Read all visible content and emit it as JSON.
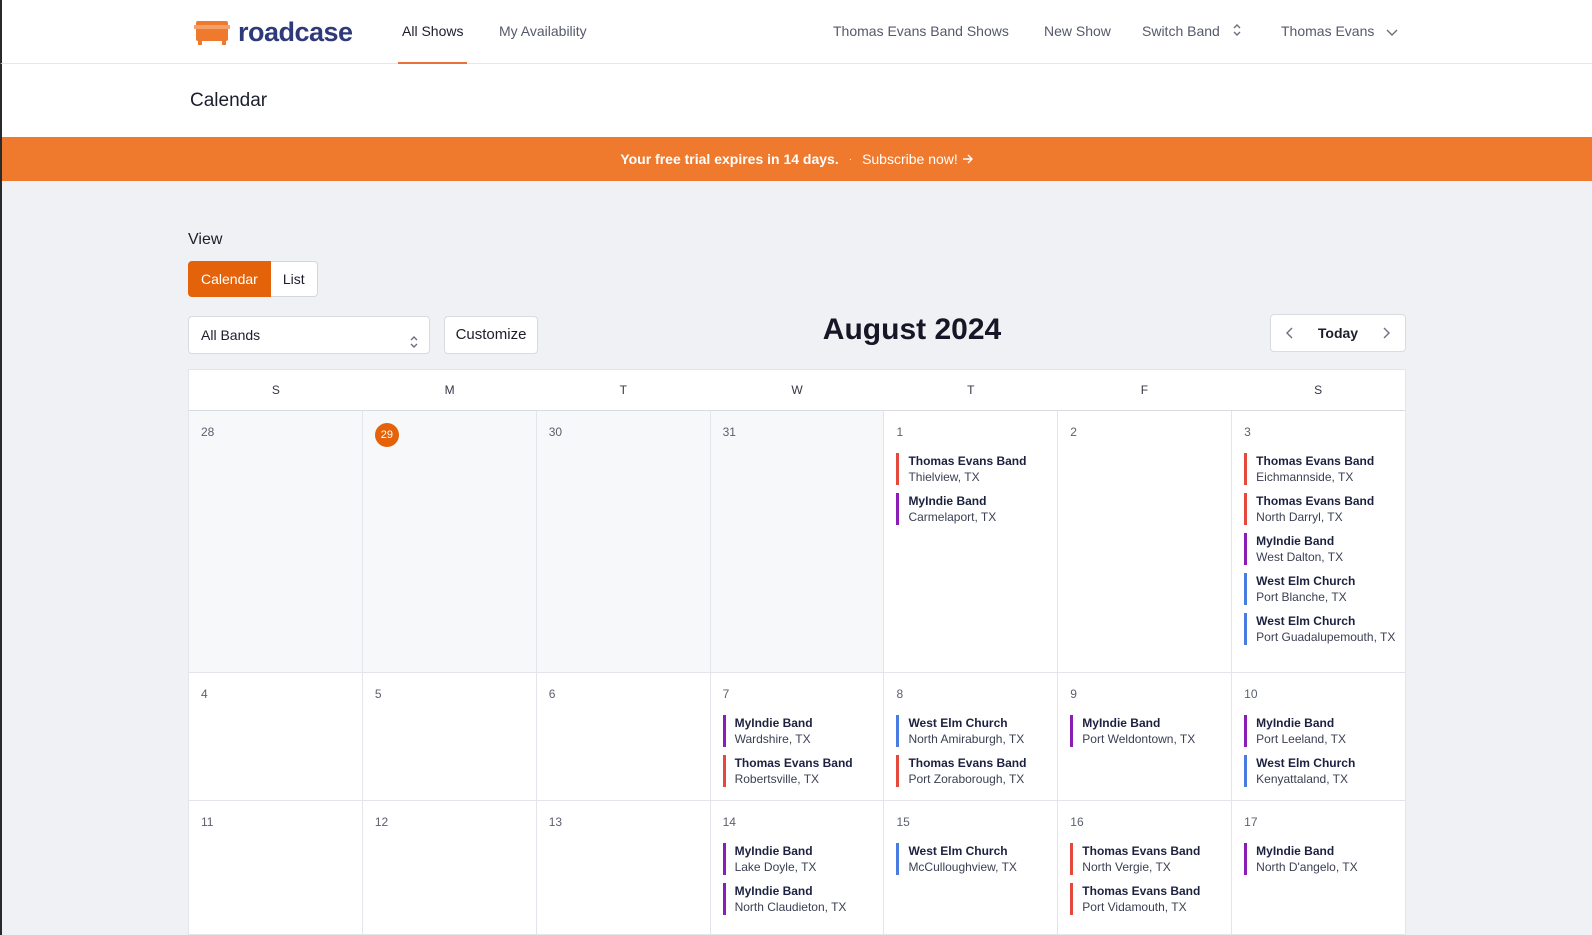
{
  "app": {
    "logo_text": "roadcase"
  },
  "nav": {
    "all_shows": "All Shows",
    "my_availability": "My Availability",
    "band_shows": "Thomas Evans Band Shows",
    "new_show": "New Show",
    "switch_band": "Switch Band",
    "user": "Thomas Evans"
  },
  "page": {
    "title": "Calendar"
  },
  "banner": {
    "message": "Your free trial expires in 14 days.",
    "separator": "·",
    "link": "Subscribe now!"
  },
  "view": {
    "label": "View",
    "calendar_btn": "Calendar",
    "list_btn": "List"
  },
  "filters": {
    "band_select": "All Bands",
    "customize": "Customize"
  },
  "month": {
    "title": "August 2024",
    "today_btn": "Today"
  },
  "colors": {
    "accent": "#e4620a",
    "banner": "#ef7a2e",
    "thomas_evans_band": "#e5483c",
    "myindie_band": "#8a1db5",
    "west_elm_church": "#4a7be0"
  },
  "weekdays": [
    "S",
    "M",
    "T",
    "W",
    "T",
    "F",
    "S"
  ],
  "weeks": [
    [
      {
        "num": "28",
        "past": true,
        "events": []
      },
      {
        "num": "29",
        "past": true,
        "today": true,
        "events": []
      },
      {
        "num": "30",
        "past": true,
        "events": []
      },
      {
        "num": "31",
        "past": true,
        "events": []
      },
      {
        "num": "1",
        "events": [
          {
            "band": "Thomas Evans Band",
            "place": "Thielview, TX",
            "color": "#e5483c"
          },
          {
            "band": "MyIndie Band",
            "place": "Carmelaport, TX",
            "color": "#8a1db5"
          }
        ]
      },
      {
        "num": "2",
        "events": []
      },
      {
        "num": "3",
        "events": [
          {
            "band": "Thomas Evans Band",
            "place": "Eichmannside, TX",
            "color": "#e5483c"
          },
          {
            "band": "Thomas Evans Band",
            "place": "North Darryl, TX",
            "color": "#e5483c"
          },
          {
            "band": "MyIndie Band",
            "place": "West Dalton, TX",
            "color": "#8a1db5"
          },
          {
            "band": "West Elm Church",
            "place": "Port Blanche, TX",
            "color": "#4a7be0"
          },
          {
            "band": "West Elm Church",
            "place": "Port Guadalupemouth, TX",
            "color": "#4a7be0"
          }
        ]
      }
    ],
    [
      {
        "num": "4",
        "events": []
      },
      {
        "num": "5",
        "events": []
      },
      {
        "num": "6",
        "events": []
      },
      {
        "num": "7",
        "events": [
          {
            "band": "MyIndie Band",
            "place": "Wardshire, TX",
            "color": "#8a1db5"
          },
          {
            "band": "Thomas Evans Band",
            "place": "Robertsville, TX",
            "color": "#e5483c"
          }
        ]
      },
      {
        "num": "8",
        "events": [
          {
            "band": "West Elm Church",
            "place": "North Amiraburgh, TX",
            "color": "#4a7be0"
          },
          {
            "band": "Thomas Evans Band",
            "place": "Port Zoraborough, TX",
            "color": "#e5483c"
          }
        ]
      },
      {
        "num": "9",
        "events": [
          {
            "band": "MyIndie Band",
            "place": "Port Weldontown, TX",
            "color": "#8a1db5"
          }
        ]
      },
      {
        "num": "10",
        "events": [
          {
            "band": "MyIndie Band",
            "place": "Port Leeland, TX",
            "color": "#8a1db5"
          },
          {
            "band": "West Elm Church",
            "place": "Kenyattaland, TX",
            "color": "#4a7be0"
          }
        ]
      }
    ],
    [
      {
        "num": "11",
        "events": []
      },
      {
        "num": "12",
        "events": []
      },
      {
        "num": "13",
        "events": []
      },
      {
        "num": "14",
        "events": [
          {
            "band": "MyIndie Band",
            "place": "Lake Doyle, TX",
            "color": "#8a1db5"
          },
          {
            "band": "MyIndie Band",
            "place": "North Claudieton, TX",
            "color": "#8a1db5"
          }
        ]
      },
      {
        "num": "15",
        "events": [
          {
            "band": "West Elm Church",
            "place": "McCulloughview, TX",
            "color": "#4a7be0"
          }
        ]
      },
      {
        "num": "16",
        "events": [
          {
            "band": "Thomas Evans Band",
            "place": "North Vergie, TX",
            "color": "#e5483c"
          },
          {
            "band": "Thomas Evans Band",
            "place": "Port Vidamouth, TX",
            "color": "#e5483c"
          }
        ]
      },
      {
        "num": "17",
        "events": [
          {
            "band": "MyIndie Band",
            "place": "North D'angelo, TX",
            "color": "#8a1db5"
          }
        ]
      }
    ]
  ]
}
